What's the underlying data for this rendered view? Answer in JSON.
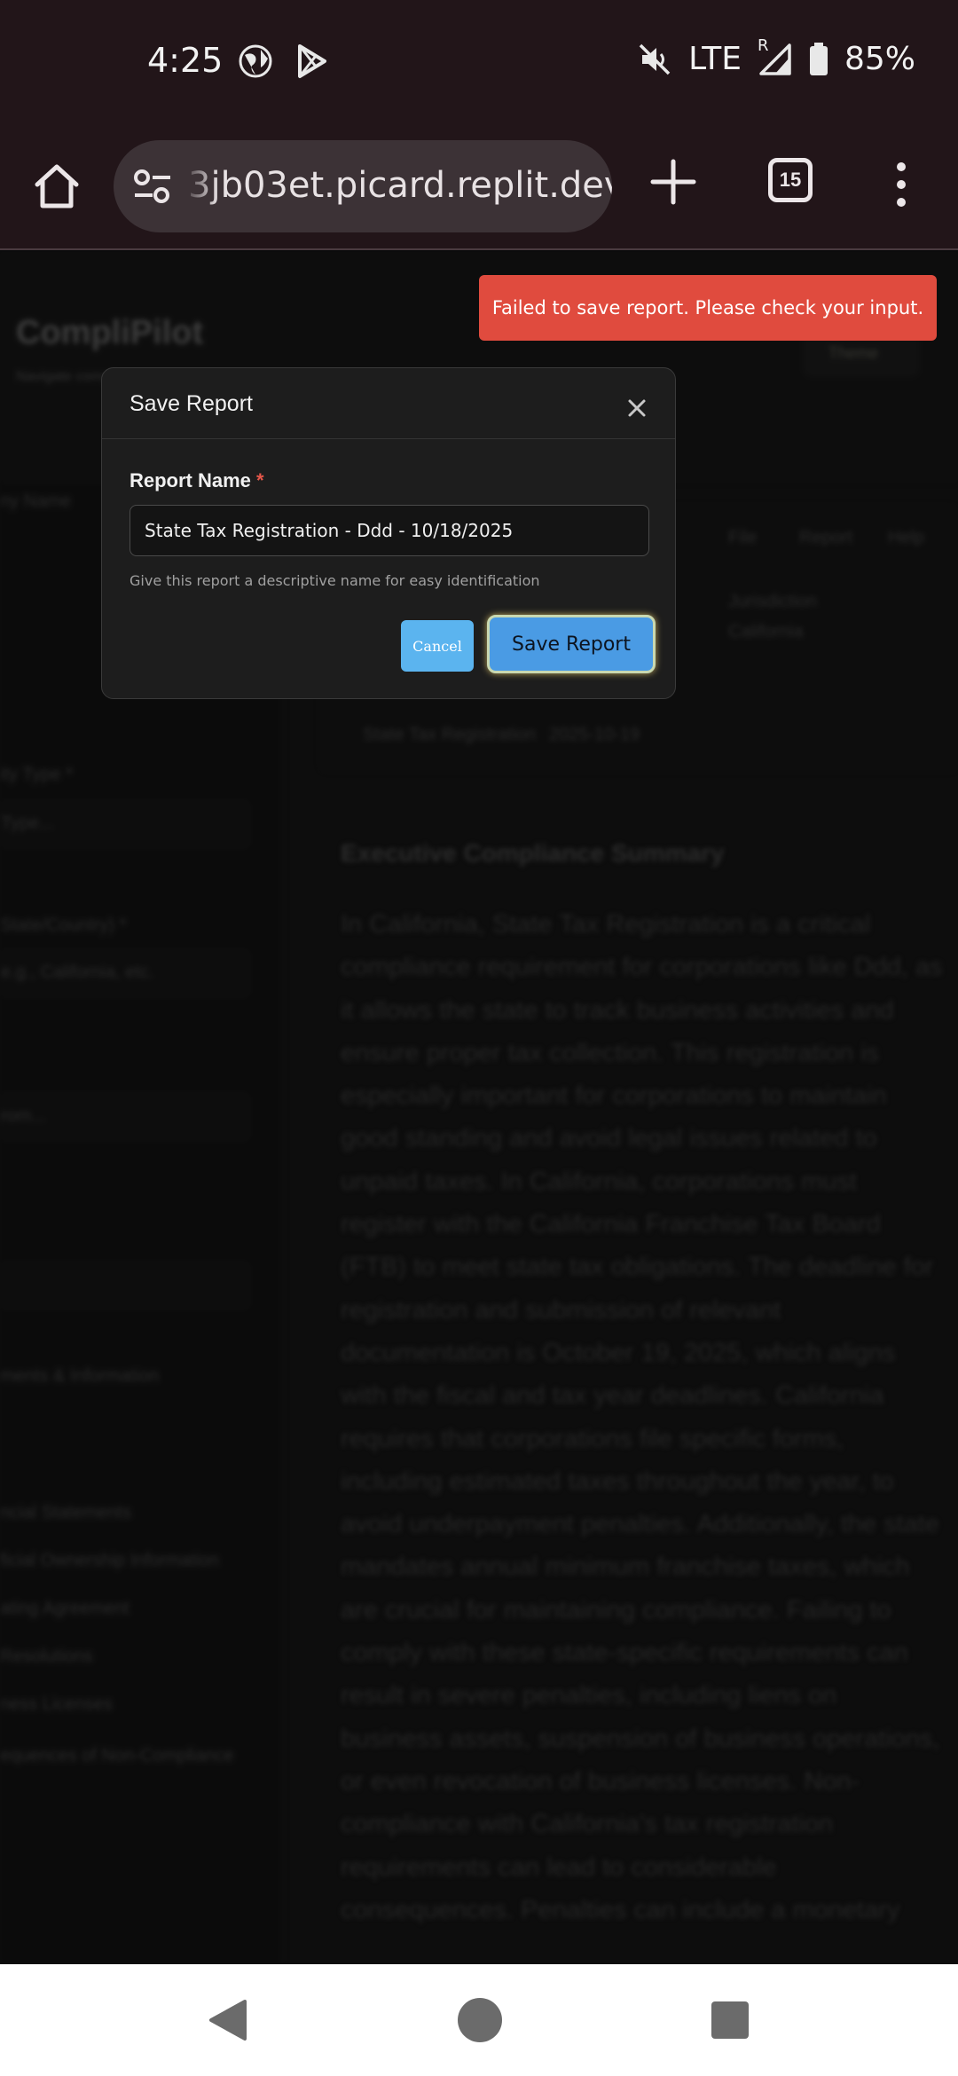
{
  "status_bar": {
    "time": "4:25",
    "network": "LTE",
    "roaming": "R",
    "battery": "85%",
    "icons": [
      "globe-icon",
      "play-store-icon",
      "mute-icon",
      "signal-icon",
      "battery-icon"
    ]
  },
  "browser": {
    "url": "3jb03et.picard.replit.dev",
    "tab_count": "15",
    "icons": [
      "home-icon",
      "site-settings-icon",
      "new-tab-icon",
      "tab-switcher-icon",
      "overflow-menu-icon"
    ]
  },
  "background_page": {
    "brand": "CompliPilot",
    "brand_sub": "Navigate compliance",
    "theme_toggle": "Theme",
    "left_labels": [
      "ny Name",
      "ity Type *",
      "State/Country) *",
      "ments & Information",
      "ncial Statements",
      "ficial Ownership Information",
      "ating Agreement",
      "Resolutions",
      "ness Licenses",
      "equences of Non-Compliance"
    ],
    "left_fields": [
      "Type...",
      "e.g., California, etc.",
      "rom..."
    ],
    "summary_heading": "Executive Compliance Summary",
    "panel_meta": [
      "Jurisdiction",
      "California",
      "State Tax Registration",
      "2025-10-19"
    ],
    "panel_tabs": [
      "File",
      "Report",
      "Help"
    ],
    "summary_text": "In California, State Tax Registration is a critical compliance requirement for corporations like Ddd, as it allows the state to track business activities and ensure proper tax collection. This registration is especially important for corporations to maintain good standing and avoid legal issues related to unpaid taxes. In California, corporations must register with the California Franchise Tax Board (FTB) to meet state tax obligations. The deadline for registration and submission of relevant documentation is October 19, 2025, which aligns with the fiscal and tax year deadlines. California requires that corporations file specific forms, including estimated taxes throughout the year, to avoid underpayment penalties. Additionally, the state mandates annual minimum franchise taxes, which are crucial for maintaining compliance. Failing to comply with these state-specific requirements can result in severe penalties, including liens on business assets, suspension of business operations, or even revocation of business licenses. Non-compliance with California's tax registration requirements can lead to considerable consequences. Penalties can include a monetary"
  },
  "toast": {
    "message": "Failed to save report. Please check your input.",
    "color": "#e04b3e"
  },
  "modal": {
    "title": "Save Report",
    "close_icon": "close-icon",
    "field_label": "Report Name",
    "required_mark": "*",
    "input_value": "State Tax Registration - Ddd - 10/18/2025",
    "help_text": "Give this report a descriptive name for easy identification",
    "cancel_label": "Cancel",
    "save_label": "Save Report",
    "accent": "#4a9be4"
  },
  "nav_bar": {
    "icons": [
      "back-icon",
      "home-circle-icon",
      "recents-icon"
    ]
  }
}
